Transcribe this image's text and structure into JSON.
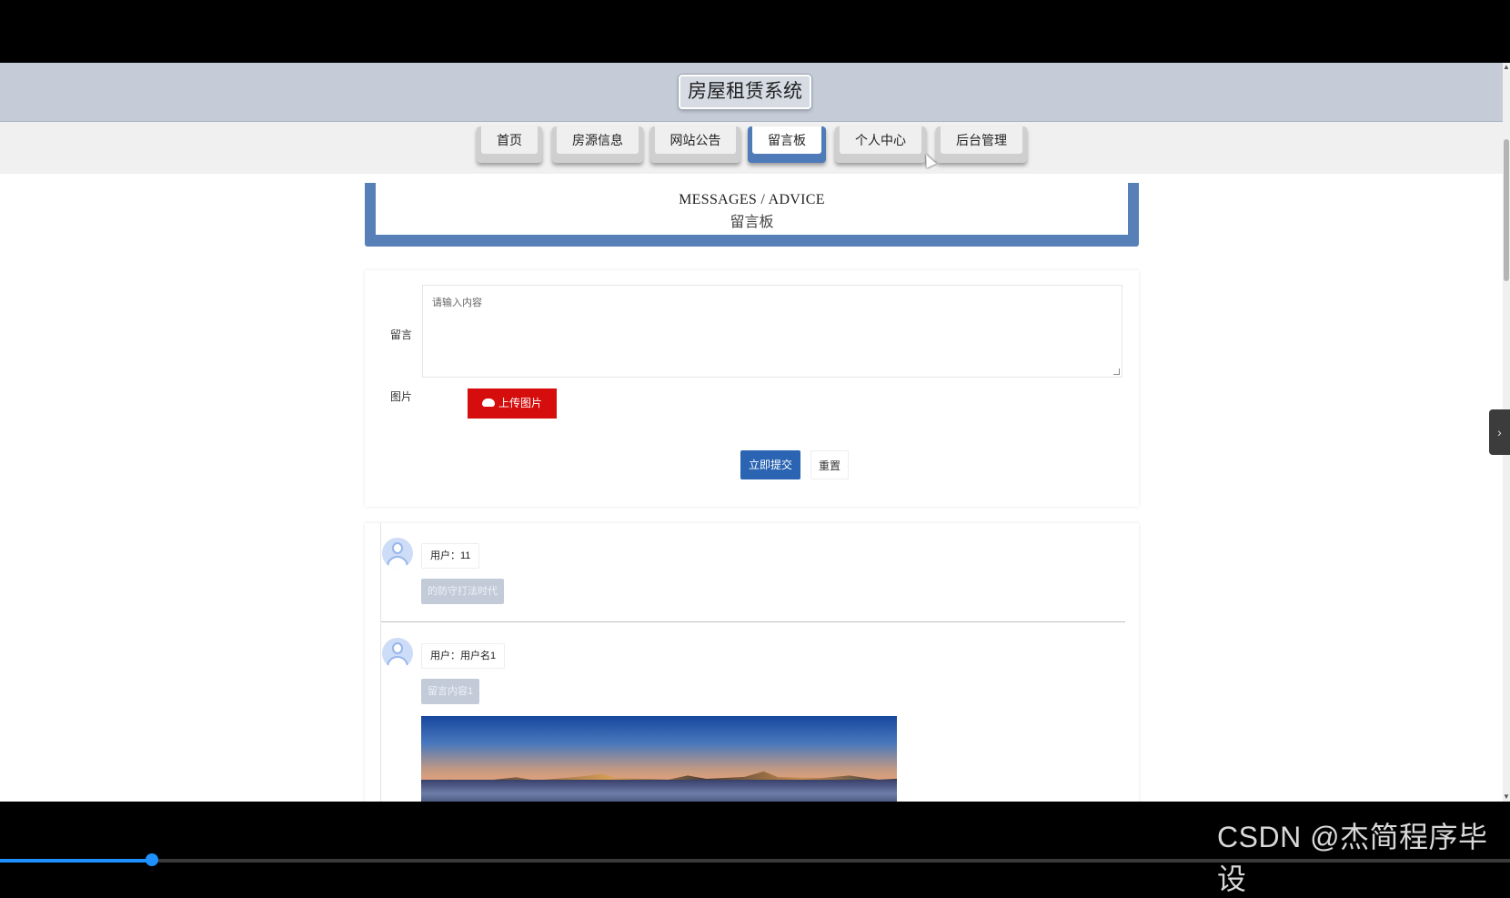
{
  "app": {
    "title": "房屋租赁系统"
  },
  "nav": {
    "items": [
      {
        "label": "首页",
        "active": false
      },
      {
        "label": "房源信息",
        "active": false
      },
      {
        "label": "网站公告",
        "active": false
      },
      {
        "label": "留言板",
        "active": true
      },
      {
        "label": "个人中心",
        "active": false
      },
      {
        "label": "后台管理",
        "active": false
      }
    ]
  },
  "banner": {
    "english": "MESSAGES / ADVICE",
    "chinese": "留言板"
  },
  "form": {
    "message_label": "留言",
    "message_placeholder": "请输入内容",
    "image_label": "图片",
    "upload_label": "上传图片",
    "upload_icon": "cloud-upload-icon",
    "submit_label": "立即提交",
    "reset_label": "重置"
  },
  "messages": [
    {
      "user": "用户：11",
      "content": "的防守打法时代",
      "has_image": false
    },
    {
      "user": "用户：用户名1",
      "content": "留言内容1",
      "has_image": true
    }
  ],
  "watermark": "CSDN @杰简程序毕设",
  "colors": {
    "header_bg": "#c5ccd8",
    "nav_active": "#4f7bb8",
    "upload_button": "#d60d0d",
    "submit_button": "#2a64b2"
  },
  "video_progress": 0.1
}
